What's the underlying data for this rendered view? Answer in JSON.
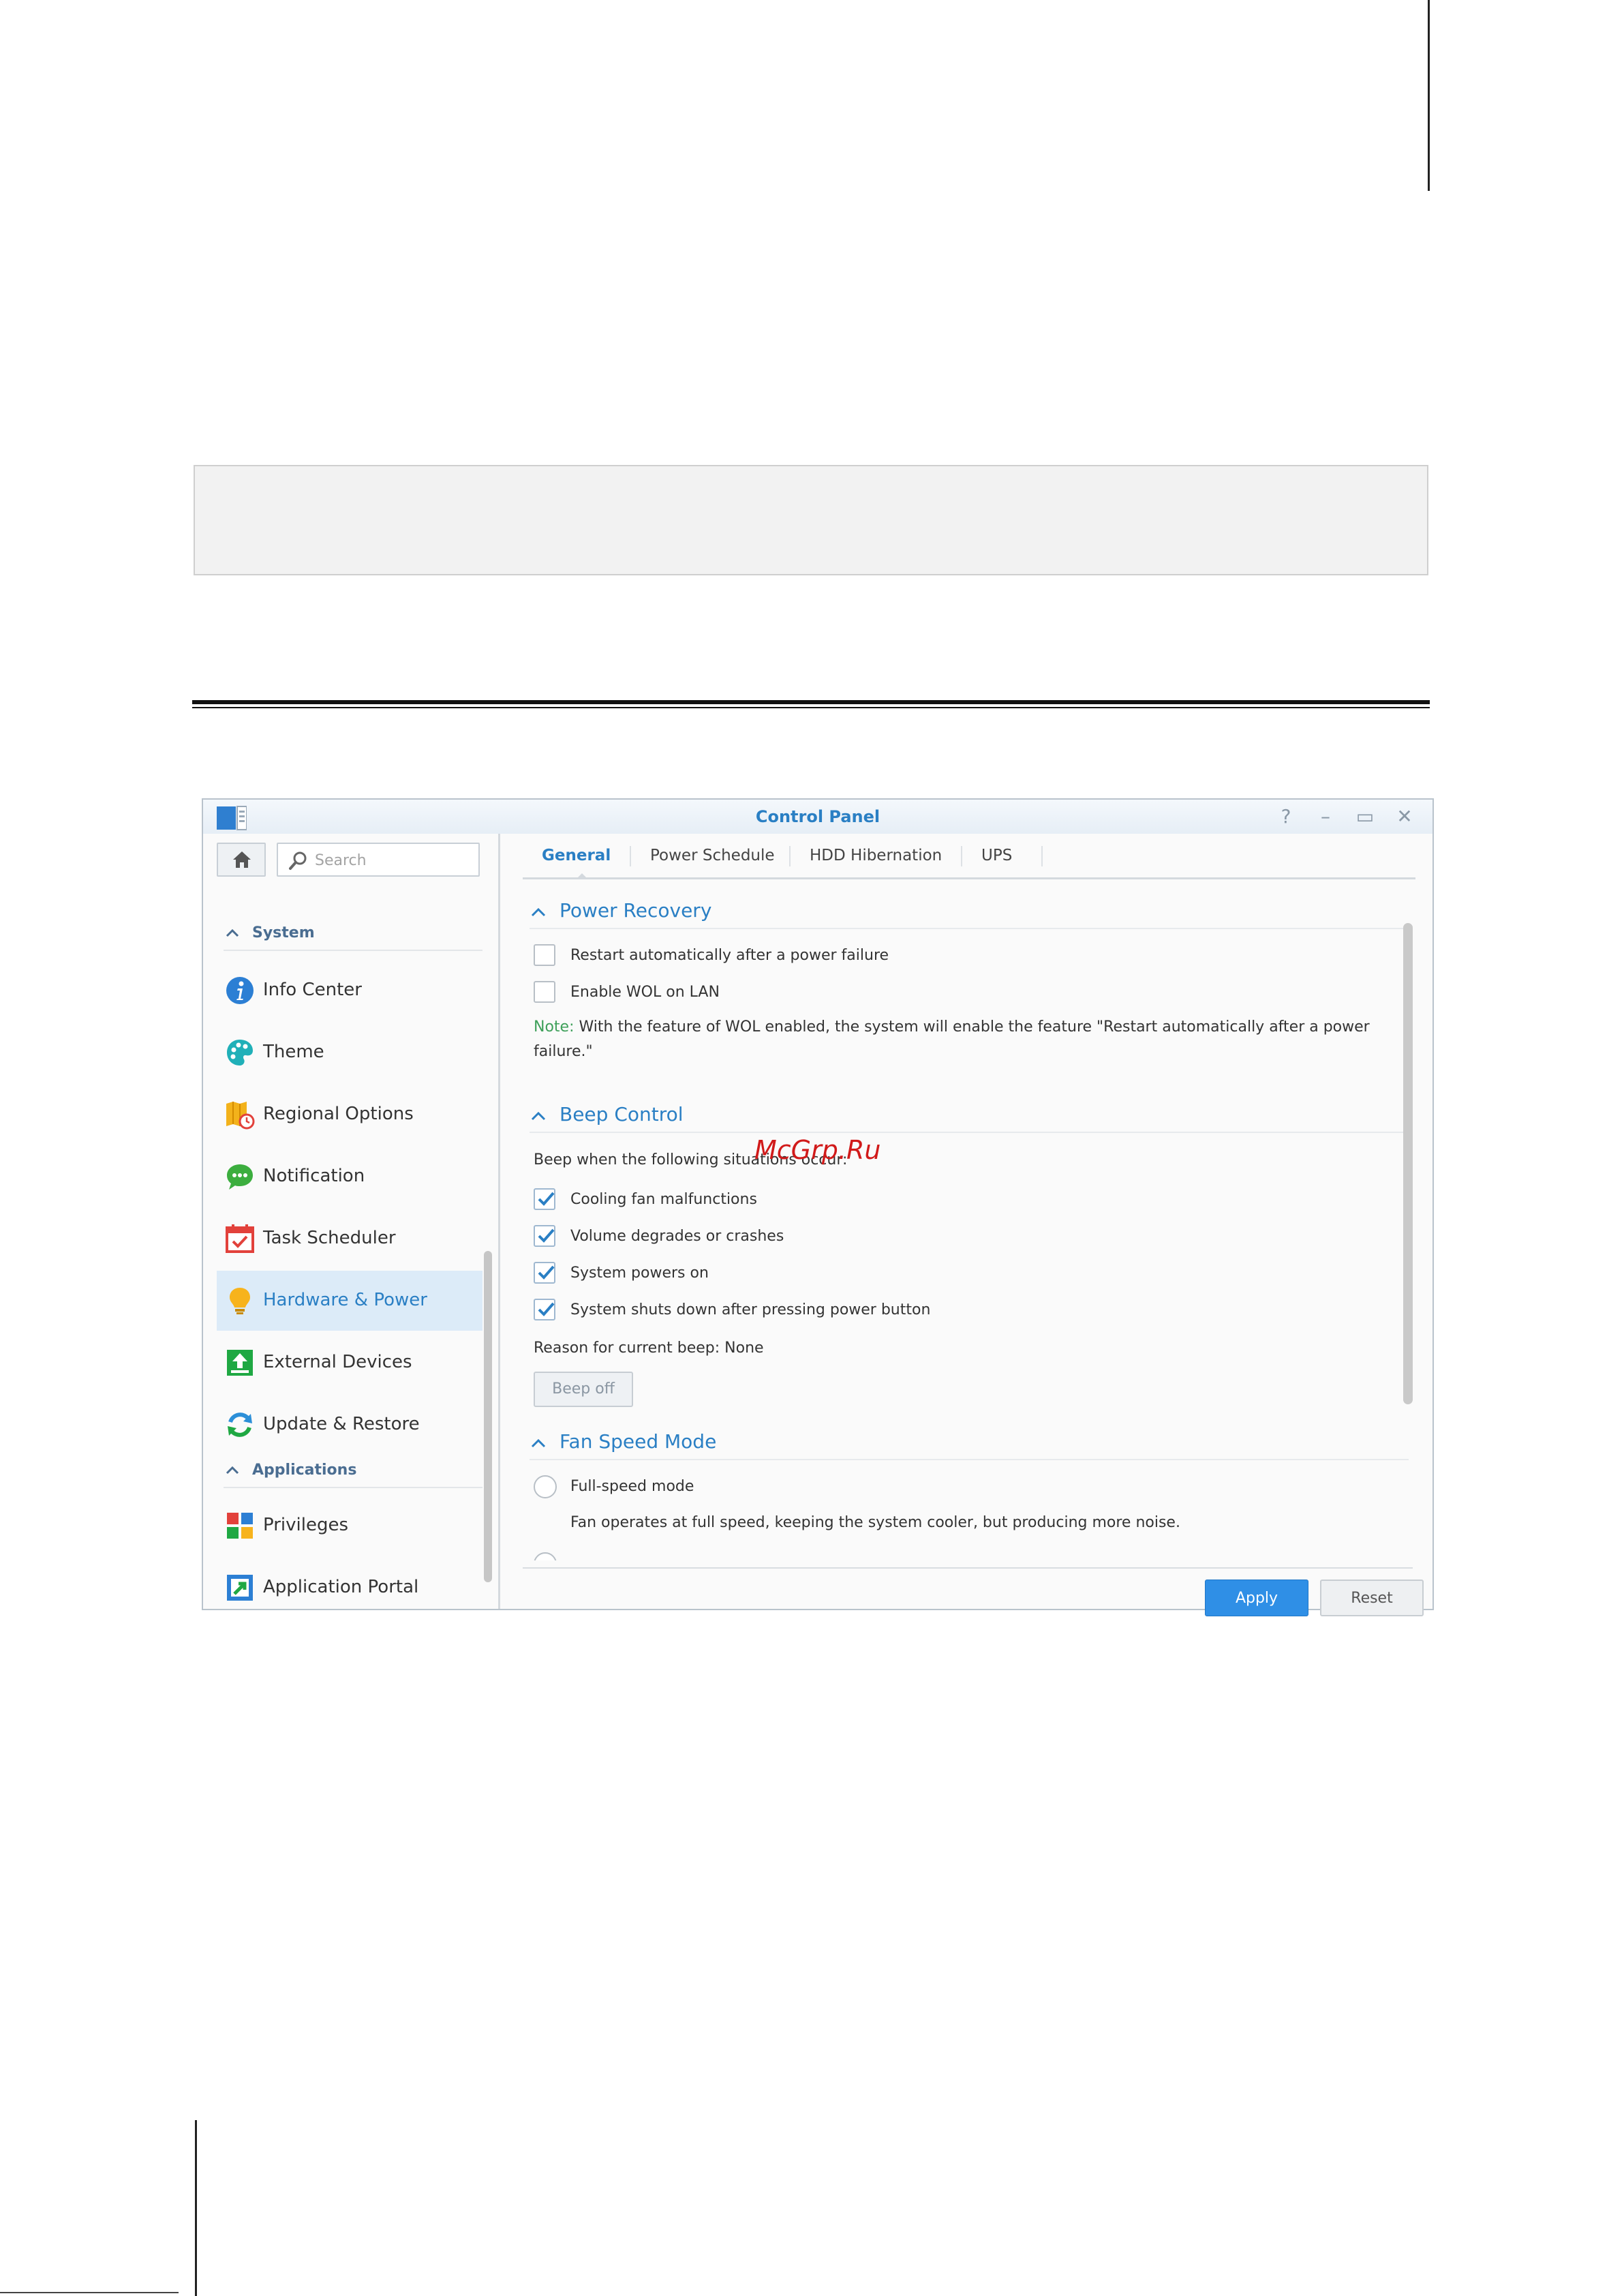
{
  "window": {
    "title": "Control Panel",
    "buttons": {
      "help": "?",
      "minimize": "–",
      "maximize": "▭",
      "close": "✕"
    }
  },
  "sidebar": {
    "search": {
      "placeholder": "Search"
    },
    "groups": [
      {
        "label": "System"
      },
      {
        "label": "Applications"
      }
    ],
    "items": [
      {
        "label": "Info Center",
        "icon": "info-icon"
      },
      {
        "label": "Theme",
        "icon": "palette-icon"
      },
      {
        "label": "Regional Options",
        "icon": "map-clock-icon"
      },
      {
        "label": "Notification",
        "icon": "chat-bubble-icon"
      },
      {
        "label": "Task Scheduler",
        "icon": "calendar-check-icon"
      },
      {
        "label": "Hardware & Power",
        "icon": "lightbulb-icon",
        "active": true
      },
      {
        "label": "External Devices",
        "icon": "upload-icon"
      },
      {
        "label": "Update & Restore",
        "icon": "refresh-icon"
      },
      {
        "label": "Privileges",
        "icon": "blocks-icon"
      },
      {
        "label": "Application Portal",
        "icon": "portal-arrow-icon"
      }
    ]
  },
  "tabs": [
    {
      "label": "General",
      "active": true
    },
    {
      "label": "Power Schedule"
    },
    {
      "label": "HDD Hibernation"
    },
    {
      "label": "UPS"
    }
  ],
  "power_recovery": {
    "title": "Power Recovery",
    "options": [
      {
        "label": "Restart automatically after a power failure",
        "checked": false
      },
      {
        "label": "Enable WOL on LAN",
        "checked": false
      }
    ],
    "note_label": "Note:",
    "note_text": " With the feature of WOL enabled, the system will enable the feature \"Restart automatically after a power failure.\""
  },
  "beep_control": {
    "title": "Beep Control",
    "intro": "Beep when the following situations occur:",
    "options": [
      {
        "label": "Cooling fan malfunctions",
        "checked": true
      },
      {
        "label": "Volume degrades or crashes",
        "checked": true
      },
      {
        "label": "System powers on",
        "checked": true
      },
      {
        "label": "System shuts down after pressing power button",
        "checked": true
      }
    ],
    "reason": "Reason for current beep: None",
    "beep_off_label": "Beep off"
  },
  "fan_speed": {
    "title": "Fan Speed Mode",
    "options": [
      {
        "label": "Full-speed mode",
        "description": "Fan operates at full speed, keeping the system cooler, but producing more noise."
      }
    ]
  },
  "footer": {
    "apply_label": "Apply",
    "reset_label": "Reset"
  },
  "watermark": "McGrp.Ru",
  "colors": {
    "accent": "#2a7fc4",
    "note_green": "#3ea05a",
    "apply_blue": "#2f8fe6",
    "active_bg": "#dcebf8"
  }
}
